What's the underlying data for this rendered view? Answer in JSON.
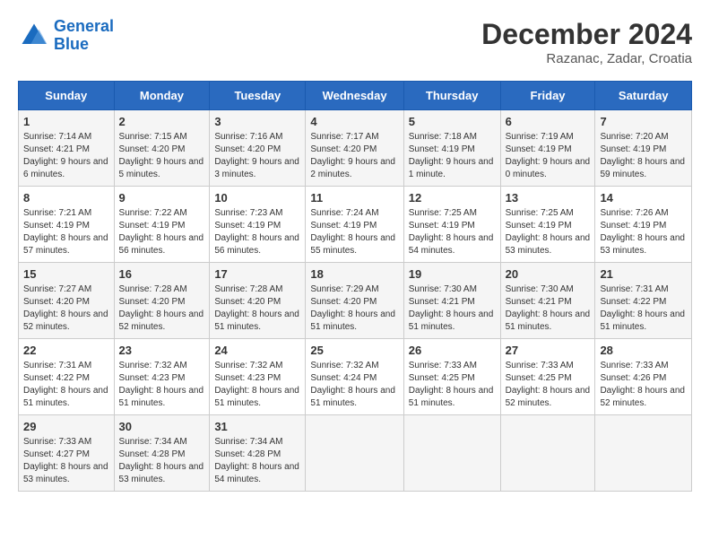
{
  "header": {
    "logo_line1": "General",
    "logo_line2": "Blue",
    "month": "December 2024",
    "location": "Razanac, Zadar, Croatia"
  },
  "days_of_week": [
    "Sunday",
    "Monday",
    "Tuesday",
    "Wednesday",
    "Thursday",
    "Friday",
    "Saturday"
  ],
  "weeks": [
    [
      {
        "day": "1",
        "sunrise": "7:14 AM",
        "sunset": "4:21 PM",
        "daylight": "9 hours and 6 minutes."
      },
      {
        "day": "2",
        "sunrise": "7:15 AM",
        "sunset": "4:20 PM",
        "daylight": "9 hours and 5 minutes."
      },
      {
        "day": "3",
        "sunrise": "7:16 AM",
        "sunset": "4:20 PM",
        "daylight": "9 hours and 3 minutes."
      },
      {
        "day": "4",
        "sunrise": "7:17 AM",
        "sunset": "4:20 PM",
        "daylight": "9 hours and 2 minutes."
      },
      {
        "day": "5",
        "sunrise": "7:18 AM",
        "sunset": "4:19 PM",
        "daylight": "9 hours and 1 minute."
      },
      {
        "day": "6",
        "sunrise": "7:19 AM",
        "sunset": "4:19 PM",
        "daylight": "9 hours and 0 minutes."
      },
      {
        "day": "7",
        "sunrise": "7:20 AM",
        "sunset": "4:19 PM",
        "daylight": "8 hours and 59 minutes."
      }
    ],
    [
      {
        "day": "8",
        "sunrise": "7:21 AM",
        "sunset": "4:19 PM",
        "daylight": "8 hours and 57 minutes."
      },
      {
        "day": "9",
        "sunrise": "7:22 AM",
        "sunset": "4:19 PM",
        "daylight": "8 hours and 56 minutes."
      },
      {
        "day": "10",
        "sunrise": "7:23 AM",
        "sunset": "4:19 PM",
        "daylight": "8 hours and 56 minutes."
      },
      {
        "day": "11",
        "sunrise": "7:24 AM",
        "sunset": "4:19 PM",
        "daylight": "8 hours and 55 minutes."
      },
      {
        "day": "12",
        "sunrise": "7:25 AM",
        "sunset": "4:19 PM",
        "daylight": "8 hours and 54 minutes."
      },
      {
        "day": "13",
        "sunrise": "7:25 AM",
        "sunset": "4:19 PM",
        "daylight": "8 hours and 53 minutes."
      },
      {
        "day": "14",
        "sunrise": "7:26 AM",
        "sunset": "4:19 PM",
        "daylight": "8 hours and 53 minutes."
      }
    ],
    [
      {
        "day": "15",
        "sunrise": "7:27 AM",
        "sunset": "4:20 PM",
        "daylight": "8 hours and 52 minutes."
      },
      {
        "day": "16",
        "sunrise": "7:28 AM",
        "sunset": "4:20 PM",
        "daylight": "8 hours and 52 minutes."
      },
      {
        "day": "17",
        "sunrise": "7:28 AM",
        "sunset": "4:20 PM",
        "daylight": "8 hours and 51 minutes."
      },
      {
        "day": "18",
        "sunrise": "7:29 AM",
        "sunset": "4:20 PM",
        "daylight": "8 hours and 51 minutes."
      },
      {
        "day": "19",
        "sunrise": "7:30 AM",
        "sunset": "4:21 PM",
        "daylight": "8 hours and 51 minutes."
      },
      {
        "day": "20",
        "sunrise": "7:30 AM",
        "sunset": "4:21 PM",
        "daylight": "8 hours and 51 minutes."
      },
      {
        "day": "21",
        "sunrise": "7:31 AM",
        "sunset": "4:22 PM",
        "daylight": "8 hours and 51 minutes."
      }
    ],
    [
      {
        "day": "22",
        "sunrise": "7:31 AM",
        "sunset": "4:22 PM",
        "daylight": "8 hours and 51 minutes."
      },
      {
        "day": "23",
        "sunrise": "7:32 AM",
        "sunset": "4:23 PM",
        "daylight": "8 hours and 51 minutes."
      },
      {
        "day": "24",
        "sunrise": "7:32 AM",
        "sunset": "4:23 PM",
        "daylight": "8 hours and 51 minutes."
      },
      {
        "day": "25",
        "sunrise": "7:32 AM",
        "sunset": "4:24 PM",
        "daylight": "8 hours and 51 minutes."
      },
      {
        "day": "26",
        "sunrise": "7:33 AM",
        "sunset": "4:25 PM",
        "daylight": "8 hours and 51 minutes."
      },
      {
        "day": "27",
        "sunrise": "7:33 AM",
        "sunset": "4:25 PM",
        "daylight": "8 hours and 52 minutes."
      },
      {
        "day": "28",
        "sunrise": "7:33 AM",
        "sunset": "4:26 PM",
        "daylight": "8 hours and 52 minutes."
      }
    ],
    [
      {
        "day": "29",
        "sunrise": "7:33 AM",
        "sunset": "4:27 PM",
        "daylight": "8 hours and 53 minutes."
      },
      {
        "day": "30",
        "sunrise": "7:34 AM",
        "sunset": "4:28 PM",
        "daylight": "8 hours and 53 minutes."
      },
      {
        "day": "31",
        "sunrise": "7:34 AM",
        "sunset": "4:28 PM",
        "daylight": "8 hours and 54 minutes."
      },
      null,
      null,
      null,
      null
    ]
  ]
}
